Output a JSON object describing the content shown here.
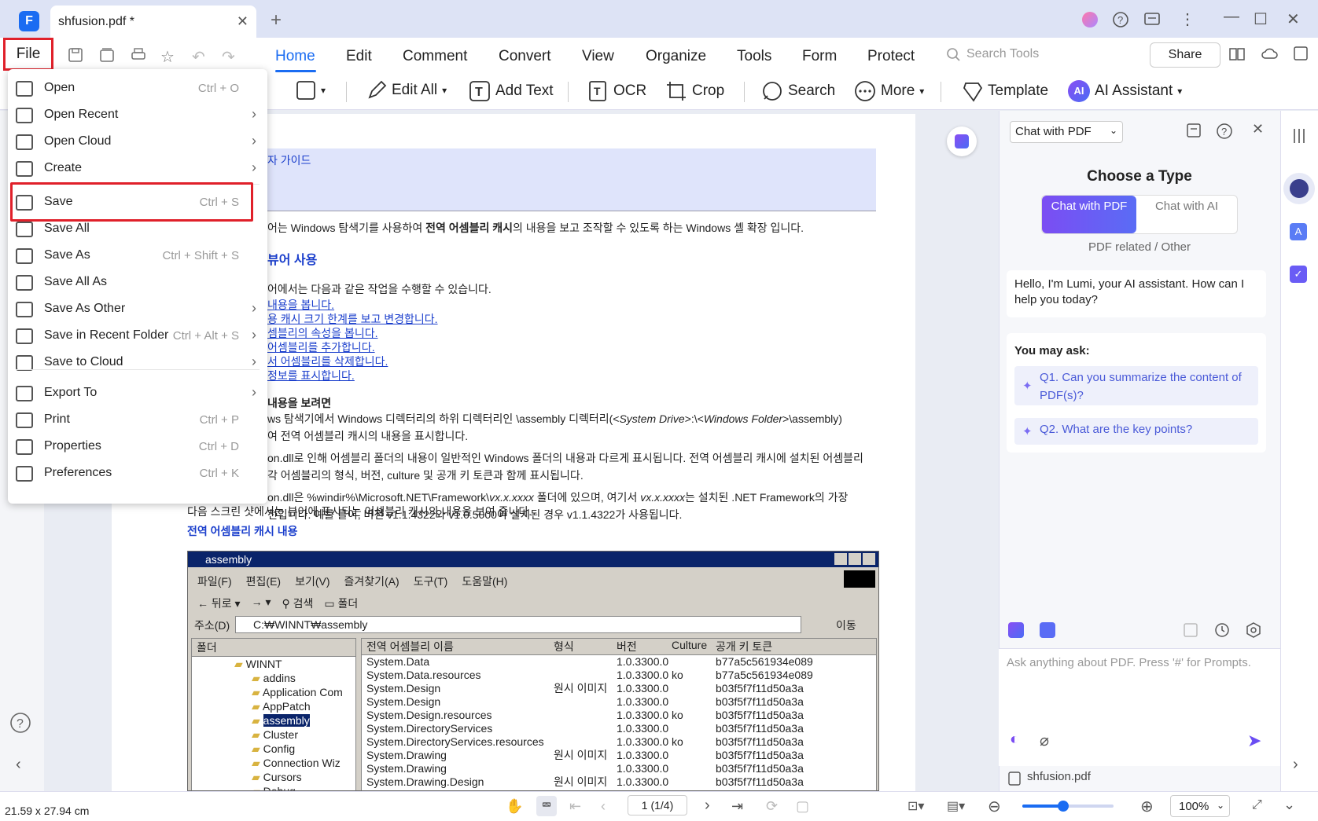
{
  "app": {
    "tab_title": "shfusion.pdf *",
    "logo": "F"
  },
  "row1": {
    "file_label": "File",
    "tabs": [
      "Home",
      "Edit",
      "Comment",
      "Convert",
      "View",
      "Organize",
      "Tools",
      "Form",
      "Protect"
    ],
    "search_placeholder": "Search Tools",
    "share_label": "Share"
  },
  "row2": {
    "edit_all": "Edit All",
    "add_text": "Add Text",
    "ocr": "OCR",
    "crop": "Crop",
    "search": "Search",
    "more": "More",
    "template": "Template",
    "ai_assistant": "AI Assistant",
    "ai_badge": "AI"
  },
  "file_menu": {
    "items": [
      {
        "label": "Open",
        "shortcut": "Ctrl + O",
        "icon": "open-icon",
        "submenu": false
      },
      {
        "label": "Open Recent",
        "shortcut": "",
        "icon": "clock-icon",
        "submenu": true
      },
      {
        "label": "Open Cloud",
        "shortcut": "",
        "icon": "cloud-icon",
        "submenu": true
      },
      {
        "label": "Create",
        "shortcut": "",
        "icon": "create-icon",
        "submenu": true
      },
      {
        "label": "Save",
        "shortcut": "Ctrl + S",
        "icon": "save-icon",
        "submenu": false
      },
      {
        "label": "Save All",
        "shortcut": "",
        "icon": "save-all-icon",
        "submenu": false
      },
      {
        "label": "Save As",
        "shortcut": "Ctrl + Shift + S",
        "icon": "save-as-icon",
        "submenu": false
      },
      {
        "label": "Save All As",
        "shortcut": "",
        "icon": "save-all-as-icon",
        "submenu": false
      },
      {
        "label": "Save As Other",
        "shortcut": "",
        "icon": "save-other-icon",
        "submenu": true
      },
      {
        "label": "Save in Recent Folder",
        "shortcut": "Ctrl + Alt + S",
        "icon": "folder-icon",
        "submenu": true
      },
      {
        "label": "Save to Cloud",
        "shortcut": "",
        "icon": "cloud-upload-icon",
        "submenu": true
      },
      {
        "label": "Export To",
        "shortcut": "",
        "icon": "export-icon",
        "submenu": true
      },
      {
        "label": "Print",
        "shortcut": "Ctrl + P",
        "icon": "print-icon",
        "submenu": false
      },
      {
        "label": "Properties",
        "shortcut": "Ctrl + D",
        "icon": "properties-icon",
        "submenu": false
      },
      {
        "label": "Preferences",
        "shortcut": "Ctrl + K",
        "icon": "preferences-icon",
        "submenu": false
      }
    ]
  },
  "doc": {
    "banner": "자 가이드",
    "intro_a": "어는 Windows 탐색기를 사용하여 ",
    "intro_b": "전역 어셈블리 캐시",
    "intro_c": "의 내용을 보고 조작할 수 있도록 하는 Windows 셸 확장 입니다.",
    "h1": "뷰어 사용",
    "p1": "어에서는 다음과 같은 작업을 수행할 수 있습니다.",
    "links": [
      "내용을 봅니다.",
      "용 캐시 크기 한계를 보고 변경합니다.",
      "셈블리의 속성을 봅니다.",
      "어셈블리를 추가합니다.",
      "서 어셈블리를 삭제합니다.",
      "정보를 표시합니다."
    ],
    "h2": "내용을 보려면",
    "l1a": "ws 탐색기에서 Windows 디렉터리의 하위 디렉터리인 \\assembly 디렉터리(<",
    "l1b": "System Drive",
    "l1c": ">:\\<",
    "l1d": "Windows Folder",
    "l1e": ">\\assembly)",
    "l2": "여 전역 어셈블리 캐시의 내용을 표시합니다.",
    "l3": "on.dll로 인해 어셈블리 폴더의 내용이 일반적인 Windows 폴더의 내용과 다르게 표시됩니다. 전역 어셈블리 캐시에 설치된 어셈블리",
    "l4": "각 어셈블리의 형식, 버전, culture 및 공개 키 토큰과 함께 표시됩니다.",
    "l5a": "on.dll은 %windir%\\Microsoft.NET\\Framework\\",
    "l5b": "vx.x.xxxx",
    "l5c": " 폴더에 있으며, 여기서 ",
    "l5d": "vx.x.xxxx",
    "l5e": "는 설치된 .NET Framework의 가장",
    "l6": "전입니다. 예를 들어, 버전 v1.1.4322와 v1.0.5000이 설치된 경우 v1.1.4322가 사용됩니다.",
    "l7": "다음 스크린 샷에서는 뷰어에 표시되는 어셈블리 캐시의 내용을 보여 줍니다.",
    "h3": "전역 어셈블리 캐시 내용"
  },
  "winshot": {
    "title": "assembly",
    "menu": [
      "파일(F)",
      "편집(E)",
      "보기(V)",
      "즐겨찾기(A)",
      "도구(T)",
      "도움말(H)"
    ],
    "back": "뒤로",
    "search": "검색",
    "folders": "폴더",
    "address_label": "주소(D)",
    "address": "C:₩WINNT₩assembly",
    "go": "이동",
    "folder_header": "폴더",
    "tree": [
      "WINNT",
      "addins",
      "Application Com",
      "AppPatch",
      "assembly",
      "Cluster",
      "Config",
      "Connection Wiz",
      "Cursors",
      "Debug"
    ],
    "cols": [
      "전역 어셈블리 이름",
      "형식",
      "버전",
      "Culture",
      "공개 키 토큰"
    ],
    "rows": [
      [
        "System.Data",
        "",
        "1.0.3300.0",
        "",
        "b77a5c561934e089"
      ],
      [
        "System.Data.resources",
        "",
        "1.0.3300.0",
        "ko",
        "b77a5c561934e089"
      ],
      [
        "System.Design",
        "원시 이미지",
        "1.0.3300.0",
        "",
        "b03f5f7f11d50a3a"
      ],
      [
        "System.Design",
        "",
        "1.0.3300.0",
        "",
        "b03f5f7f11d50a3a"
      ],
      [
        "System.Design.resources",
        "",
        "1.0.3300.0",
        "ko",
        "b03f5f7f11d50a3a"
      ],
      [
        "System.DirectoryServices",
        "",
        "1.0.3300.0",
        "",
        "b03f5f7f11d50a3a"
      ],
      [
        "System.DirectoryServices.resources",
        "",
        "1.0.3300.0",
        "ko",
        "b03f5f7f11d50a3a"
      ],
      [
        "System.Drawing",
        "원시 이미지",
        "1.0.3300.0",
        "",
        "b03f5f7f11d50a3a"
      ],
      [
        "System.Drawing",
        "",
        "1.0.3300.0",
        "",
        "b03f5f7f11d50a3a"
      ],
      [
        "System.Drawing.Design",
        "원시 이미지",
        "1.0.3300.0",
        "",
        "b03f5f7f11d50a3a"
      ]
    ]
  },
  "ai_panel": {
    "mode": "Chat with PDF",
    "choose": "Choose a Type",
    "seg1": "Chat with PDF",
    "seg2": "Chat with AI",
    "sub": "PDF related / Other",
    "hello": "Hello, I'm Lumi, your AI assistant. How can I help you today?",
    "you_may_ask": "You may ask:",
    "q1": "Q1. Can you summarize the content of PDF(s)?",
    "q2": "Q2. What are the key points?",
    "input_placeholder": "Ask anything about PDF. Press '#' for Prompts.",
    "file": "shfusion.pdf"
  },
  "status": {
    "dims": "21.59 x 27.94 cm",
    "page": "1 (1/4)",
    "zoom": "100%",
    "zoom_fraction": 0.45
  },
  "colors": {
    "accent": "#1a6cf2",
    "highlight": "#e0202a",
    "ai_purple": "#7b4df3"
  }
}
